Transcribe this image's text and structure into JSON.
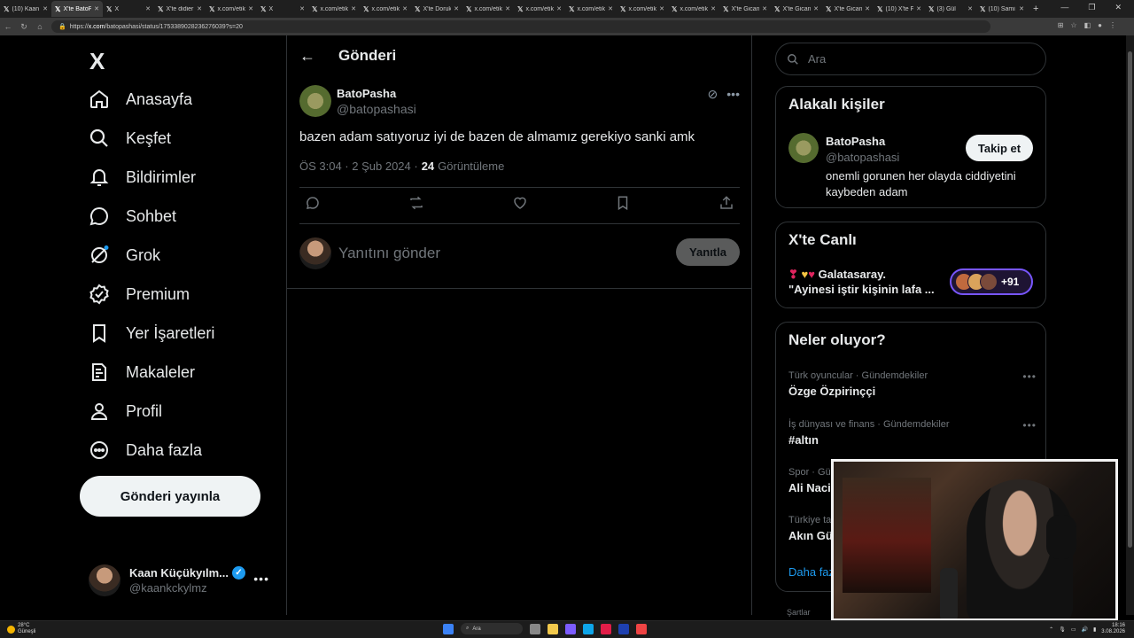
{
  "browser": {
    "tabs": [
      {
        "label": "(10) Kaan",
        "active": false
      },
      {
        "label": "X'te BatoP",
        "active": true
      },
      {
        "label": "X",
        "active": false
      },
      {
        "label": "X'te didier",
        "active": false
      },
      {
        "label": "x.com/etik",
        "active": false
      },
      {
        "label": "X",
        "active": false
      },
      {
        "label": "x.com/etik",
        "active": false
      },
      {
        "label": "x.com/etik",
        "active": false
      },
      {
        "label": "X'te Doruk",
        "active": false
      },
      {
        "label": "x.com/etik",
        "active": false
      },
      {
        "label": "x.com/etik",
        "active": false
      },
      {
        "label": "x.com/etik",
        "active": false
      },
      {
        "label": "x.com/etik",
        "active": false
      },
      {
        "label": "x.com/etik",
        "active": false
      },
      {
        "label": "X'te Gican",
        "active": false
      },
      {
        "label": "X'te Gican",
        "active": false
      },
      {
        "label": "X'te Gican",
        "active": false
      },
      {
        "label": "(10) X'te Fi",
        "active": false
      },
      {
        "label": "(3) Gül",
        "active": false
      },
      {
        "label": "(10) Sami",
        "active": false
      }
    ],
    "url_prefix": "https://",
    "url_domain": "x.com",
    "url_path": "/batopashasi/status/1753389028236276039?s=20"
  },
  "sidebar": {
    "logo": "X",
    "items": [
      {
        "label": "Anasayfa",
        "icon": "home-icon"
      },
      {
        "label": "Keşfet",
        "icon": "search-icon"
      },
      {
        "label": "Bildirimler",
        "icon": "bell-icon"
      },
      {
        "label": "Sohbet",
        "icon": "chat-icon"
      },
      {
        "label": "Grok",
        "icon": "grok-icon"
      },
      {
        "label": "Premium",
        "icon": "premium-icon"
      },
      {
        "label": "Yer İşaretleri",
        "icon": "bookmark-icon"
      },
      {
        "label": "Makaleler",
        "icon": "article-icon"
      },
      {
        "label": "Profil",
        "icon": "person-icon"
      },
      {
        "label": "Daha fazla",
        "icon": "more-circle-icon"
      }
    ],
    "post_button": "Gönderi yayınla",
    "account": {
      "name": "Kaan Küçükyılm...",
      "handle": "@kaankckylmz"
    }
  },
  "main": {
    "header_title": "Gönderi",
    "tweet": {
      "author_name": "BatoPasha",
      "author_handle": "@batopashasi",
      "text": "bazen adam satıyoruz iyi de bazen de almamız gerekiyo sanki amk",
      "time": "ÖS 3:04 · 2 Şub 2024 · ",
      "views_count": "24",
      "views_label": "Görüntüleme"
    },
    "reply": {
      "placeholder": "Yanıtını gönder",
      "button": "Yanıtla"
    }
  },
  "right": {
    "search_placeholder": "Ara",
    "related": {
      "title": "Alakalı kişiler",
      "name": "BatoPasha",
      "handle": "@batopashasi",
      "bio": "onemli gorunen her olayda ciddiyetini kaybeden adam",
      "follow": "Takip et"
    },
    "live": {
      "title": "X'te Canlı",
      "line1": "Galatasaray.",
      "line2": "\"Ayinesi iştir kişinin lafa ...",
      "count": "+91"
    },
    "trends": {
      "title": "Neler oluyor?",
      "items": [
        {
          "category": "Türk oyuncular · Gündemdekiler",
          "name": "Özge Özpirinççi"
        },
        {
          "category": "İş dünyası ve finans · Gündemdekiler",
          "name": "#altın"
        },
        {
          "category": "Spor · Gü",
          "name": "Ali Naci"
        },
        {
          "category": "Türkiye ta",
          "name": "Akın Gü"
        }
      ],
      "show_more": "Daha faz"
    },
    "terms": "Şartlar"
  },
  "taskbar": {
    "temp": "28°C",
    "weather": "Güneşli",
    "search": "Ara",
    "time": "18:16",
    "date": "3.08.2026"
  }
}
